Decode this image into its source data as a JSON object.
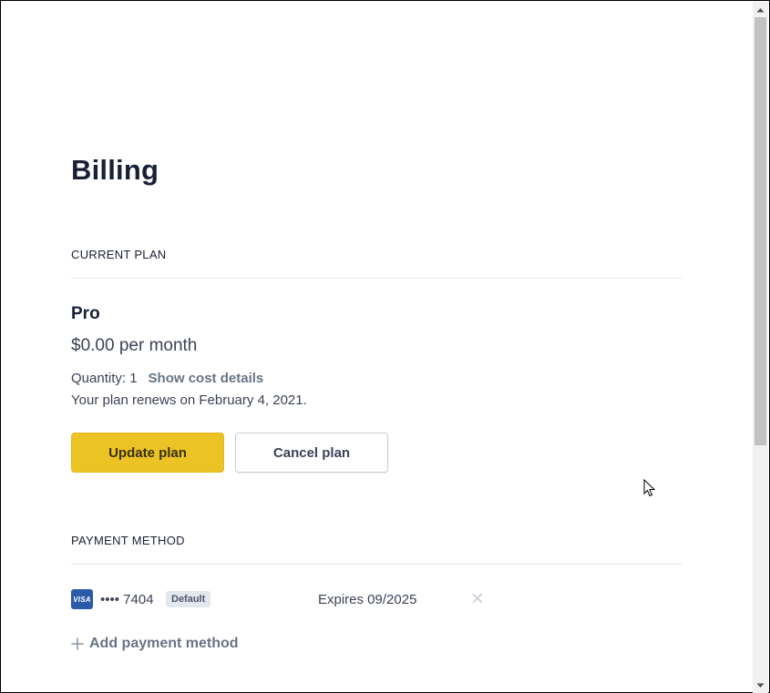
{
  "page": {
    "title": "Billing"
  },
  "current_plan": {
    "section_label": "CURRENT PLAN",
    "plan_name": "Pro",
    "price": "$0.00 per month",
    "quantity_text": "Quantity: 1",
    "show_cost_link": "Show cost details",
    "renewal_text": "Your plan renews on February 4, 2021.",
    "update_button": "Update plan",
    "cancel_button": "Cancel plan"
  },
  "payment_method": {
    "section_label": "PAYMENT METHOD",
    "card": {
      "brand": "VISA",
      "number": "•••• 7404",
      "badge": "Default",
      "expires": "Expires 09/2025"
    },
    "add_link": "Add payment method"
  },
  "colors": {
    "primary_button": "#ecc325",
    "text_dark": "#1a1f36",
    "text_muted": "#697386",
    "card_brand": "#2a5aa8"
  },
  "icons": {
    "remove": "close-icon",
    "add": "plus-icon",
    "card": "visa-card-icon"
  }
}
